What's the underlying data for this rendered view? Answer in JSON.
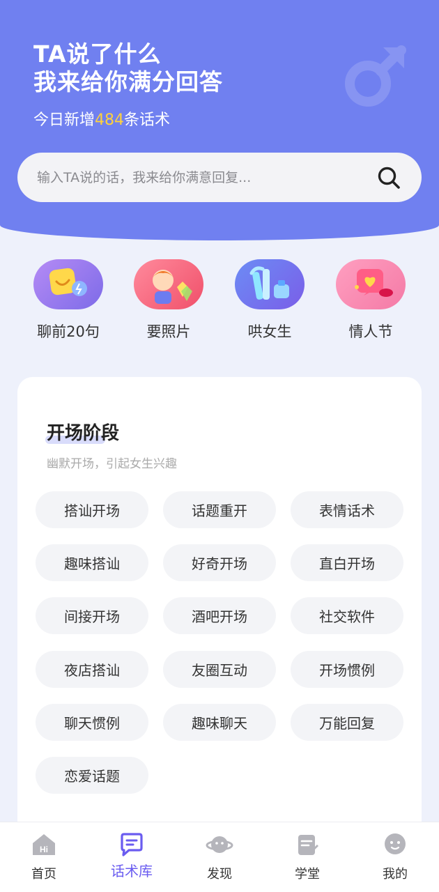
{
  "hero": {
    "title_line1": "TA说了什么",
    "title_line2": "我来给你满分回答",
    "sub_prefix": "今日新增",
    "sub_count": "484",
    "sub_suffix": "条话术",
    "highlight_color": "#ffd23c"
  },
  "search": {
    "placeholder": "输入TA说的话，我来给你满意回复..."
  },
  "shortcuts": [
    {
      "label": "聊前20句",
      "icon": "chat-emoji-icon"
    },
    {
      "label": "要照片",
      "icon": "person-photo-icon"
    },
    {
      "label": "哄女生",
      "icon": "cosmetics-icon"
    },
    {
      "label": "情人节",
      "icon": "love-letter-icon"
    }
  ],
  "section": {
    "title": "开场阶段",
    "desc": "幽默开场，引起女生兴趣",
    "tags": [
      "搭讪开场",
      "话题重开",
      "表情话术",
      "趣味搭讪",
      "好奇开场",
      "直白开场",
      "间接开场",
      "酒吧开场",
      "社交软件",
      "夜店搭讪",
      "友圈互动",
      "开场惯例",
      "聊天惯例",
      "趣味聊天",
      "万能回复",
      "恋爱话题"
    ]
  },
  "tabbar": {
    "active_color": "#6a5cf0",
    "items": [
      {
        "label": "首页",
        "icon": "home-hi-icon"
      },
      {
        "label": "话术库",
        "icon": "chat-library-icon"
      },
      {
        "label": "发现",
        "icon": "planet-icon"
      },
      {
        "label": "学堂",
        "icon": "notebook-icon"
      },
      {
        "label": "我的",
        "icon": "profile-face-icon"
      }
    ]
  }
}
